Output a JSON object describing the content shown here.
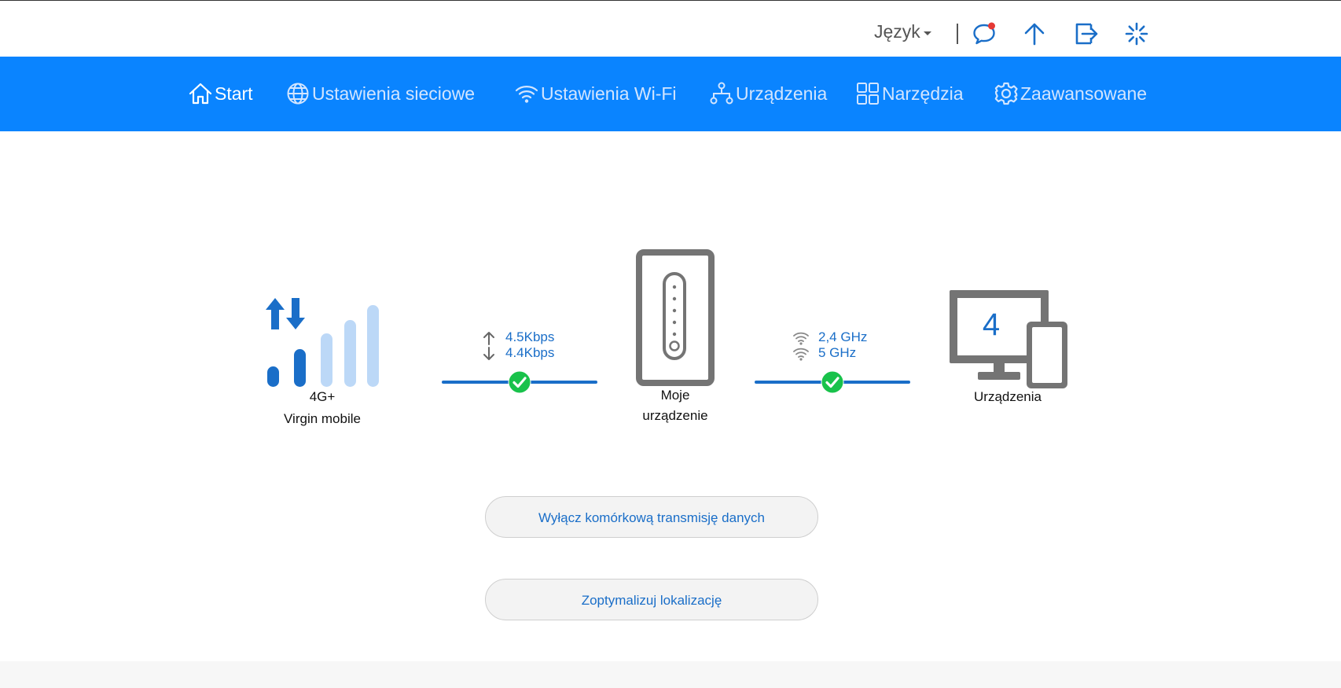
{
  "header": {
    "language_label": "Język",
    "icons": [
      "messages-icon",
      "update-icon",
      "logout-icon",
      "loading-icon"
    ]
  },
  "nav": {
    "items": [
      {
        "label": "Start",
        "icon": "home-icon",
        "active": true
      },
      {
        "label": "Ustawienia sieciowe",
        "icon": "globe-icon",
        "active": false
      },
      {
        "label": "Ustawienia Wi-Fi",
        "icon": "wifi-icon",
        "active": false
      },
      {
        "label": "Urządzenia",
        "icon": "topology-icon",
        "active": false
      },
      {
        "label": "Narzędzia",
        "icon": "grid-icon",
        "active": false
      },
      {
        "label": "Zaawansowane",
        "icon": "gear-icon",
        "active": false
      }
    ]
  },
  "status": {
    "network_type": "4G+",
    "operator": "Virgin mobile",
    "upload_rate": "4.5Kbps",
    "download_rate": "4.4Kbps",
    "device_label_line1": "Moje",
    "device_label_line2": "urządzenie",
    "wifi_band_1": "2,4 GHz",
    "wifi_band_2": "5 GHz",
    "connected_devices_count": "4",
    "connected_devices_label": "Urządzenia",
    "signal_level": 2,
    "signal_max": 5
  },
  "actions": {
    "disable_mobile_data": "Wyłącz komórkową transmisję danych",
    "optimize_location": "Zoptymalizuj lokalizację"
  },
  "colors": {
    "nav_background": "#0a84ff",
    "accent": "#1a6ec8",
    "success": "#19c24b",
    "device_gray": "#747474"
  }
}
